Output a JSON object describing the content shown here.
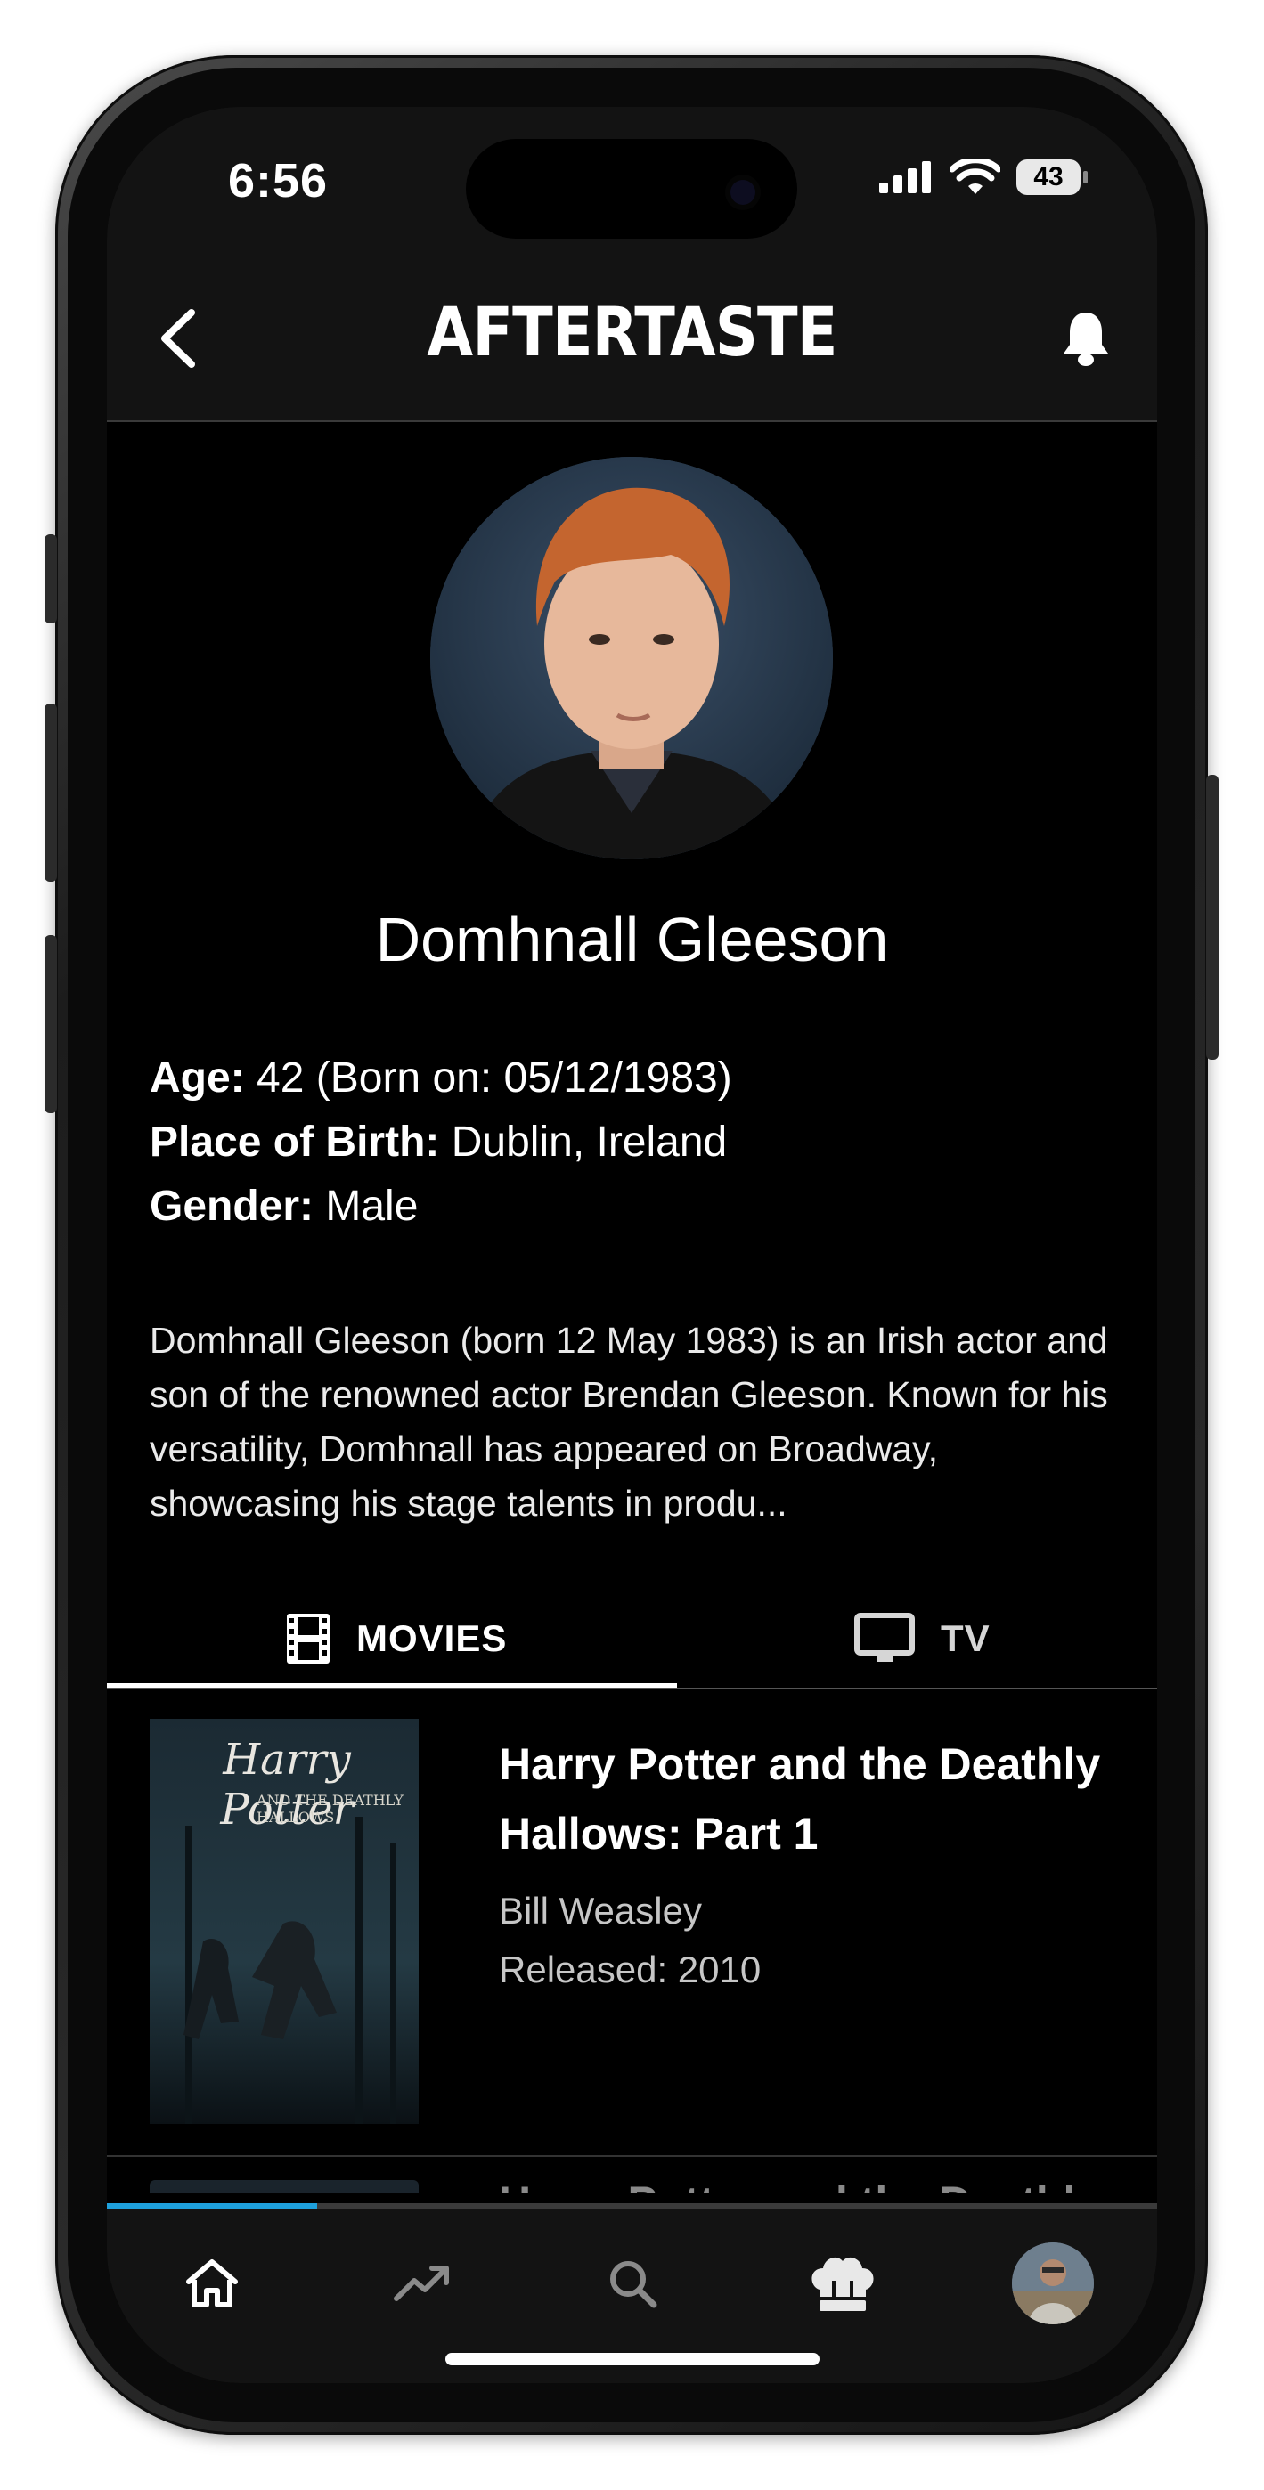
{
  "status_bar": {
    "time": "6:56",
    "battery": "43"
  },
  "header": {
    "title": "AFTERTASTE",
    "back_icon": "chevron-left-icon",
    "notifications_icon": "bell-icon"
  },
  "person": {
    "name": "Domhnall Gleeson",
    "age_label": "Age:",
    "age_value": "42 (Born on: 05/12/1983)",
    "birthplace_label": "Place of Birth:",
    "birthplace_value": "Dublin, Ireland",
    "gender_label": "Gender:",
    "gender_value": "Male",
    "bio": "Domhnall Gleeson (born 12 May 1983) is an Irish actor and son of the renowned actor Brendan Gleeson. Known for his versatility, Domhnall has appeared on Broadway, showcasing his stage talents in produ..."
  },
  "tabs": [
    {
      "label": "MOVIES",
      "icon": "film-icon",
      "selected": true
    },
    {
      "label": "TV",
      "icon": "tv-icon",
      "selected": false
    }
  ],
  "movies": [
    {
      "title": "Harry Potter and the Deathly Hallows: Part 1",
      "role": "Bill Weasley",
      "released": "Released: 2010",
      "poster_text": "Harry Potter",
      "poster_subtext": "and the Deathly Hallows"
    },
    {
      "title": "Harry Potter and the Deathly"
    }
  ],
  "scroll_progress": 0.2,
  "bottom_nav": [
    {
      "name": "home",
      "icon": "home-icon",
      "active": true
    },
    {
      "name": "trending",
      "icon": "trending-icon",
      "active": false
    },
    {
      "name": "search",
      "icon": "search-icon",
      "active": false
    },
    {
      "name": "chef",
      "icon": "chef-hat-icon",
      "active": false
    },
    {
      "name": "profile",
      "icon": "avatar",
      "active": false
    }
  ],
  "colors": {
    "background": "#000000",
    "bar_background": "#131313",
    "accent": "#1ea0dc",
    "text": "#ffffff",
    "muted_text": "#c6c6c6"
  }
}
